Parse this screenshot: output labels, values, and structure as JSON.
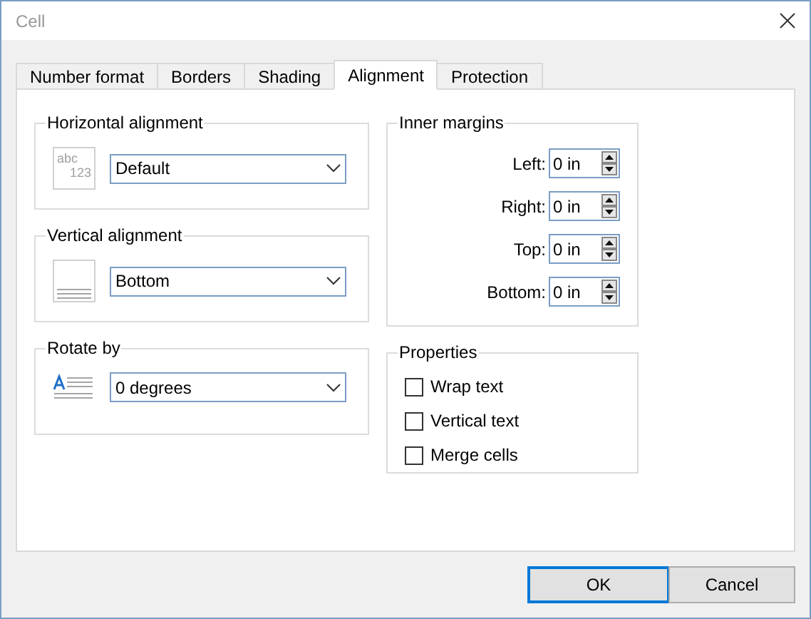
{
  "window": {
    "title": "Cell"
  },
  "tabs": [
    {
      "label": "Number format",
      "selected": false
    },
    {
      "label": "Borders",
      "selected": false
    },
    {
      "label": "Shading",
      "selected": false
    },
    {
      "label": "Alignment",
      "selected": true
    },
    {
      "label": "Protection",
      "selected": false
    }
  ],
  "left_groups": [
    {
      "title": "Horizontal alignment",
      "kind": "abc",
      "icon_text": [
        "abc",
        "123"
      ],
      "value": "Default"
    },
    {
      "title": "Vertical alignment",
      "kind": "bottom",
      "value": "Bottom"
    },
    {
      "title": "Rotate by",
      "kind": "rotate",
      "value": "0 degrees"
    }
  ],
  "inner_margins": {
    "title": "Inner margins",
    "fields": [
      {
        "label": "Left:",
        "value": "0 in"
      },
      {
        "label": "Right:",
        "value": "0 in"
      },
      {
        "label": "Top:",
        "value": "0 in"
      },
      {
        "label": "Bottom:",
        "value": "0 in"
      }
    ]
  },
  "properties": {
    "title": "Properties",
    "options": [
      {
        "label": "Wrap text",
        "checked": false
      },
      {
        "label": "Vertical text",
        "checked": false
      },
      {
        "label": "Merge cells",
        "checked": false
      }
    ]
  },
  "buttons": [
    {
      "label": "OK",
      "default": true
    },
    {
      "label": "Cancel",
      "default": false
    }
  ]
}
